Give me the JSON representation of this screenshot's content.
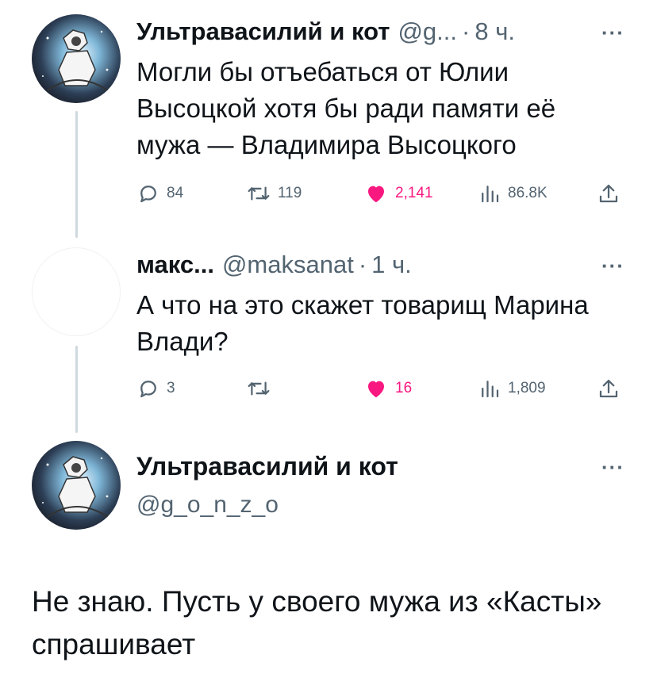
{
  "tweet1": {
    "author_name": "Ультравасилий и кот",
    "handle": "@g...",
    "separator": "·",
    "time": "8 ч.",
    "more": "···",
    "text": "Могли бы отъебаться от Юлии Высоцкой хотя бы ради памяти её мужа — Владимира Высоцкого",
    "replies": "84",
    "retweets": "119",
    "likes": "2,141",
    "views": "86.8K"
  },
  "tweet2": {
    "author_name": "макс...",
    "handle": "@maksanat",
    "separator": "·",
    "time": "1 ч.",
    "more": "···",
    "text": "А что на это скажет товарищ Марина Влади?",
    "replies": "3",
    "retweets": "",
    "likes": "16",
    "views": "1,809"
  },
  "main_tweet": {
    "author_name": "Ультравасилий и кот",
    "handle": "@g_o_n_z_o",
    "more": "···",
    "text": "Не знаю. Пусть у своего мужа из «Касты» спрашивает"
  },
  "colors": {
    "text": "#0f1419",
    "secondary": "#536471",
    "like": "#f91880",
    "thread_line": "#cfd9de"
  },
  "icons": [
    "reply-icon",
    "retweet-icon",
    "like-icon",
    "views-icon",
    "share-icon",
    "more-icon"
  ]
}
